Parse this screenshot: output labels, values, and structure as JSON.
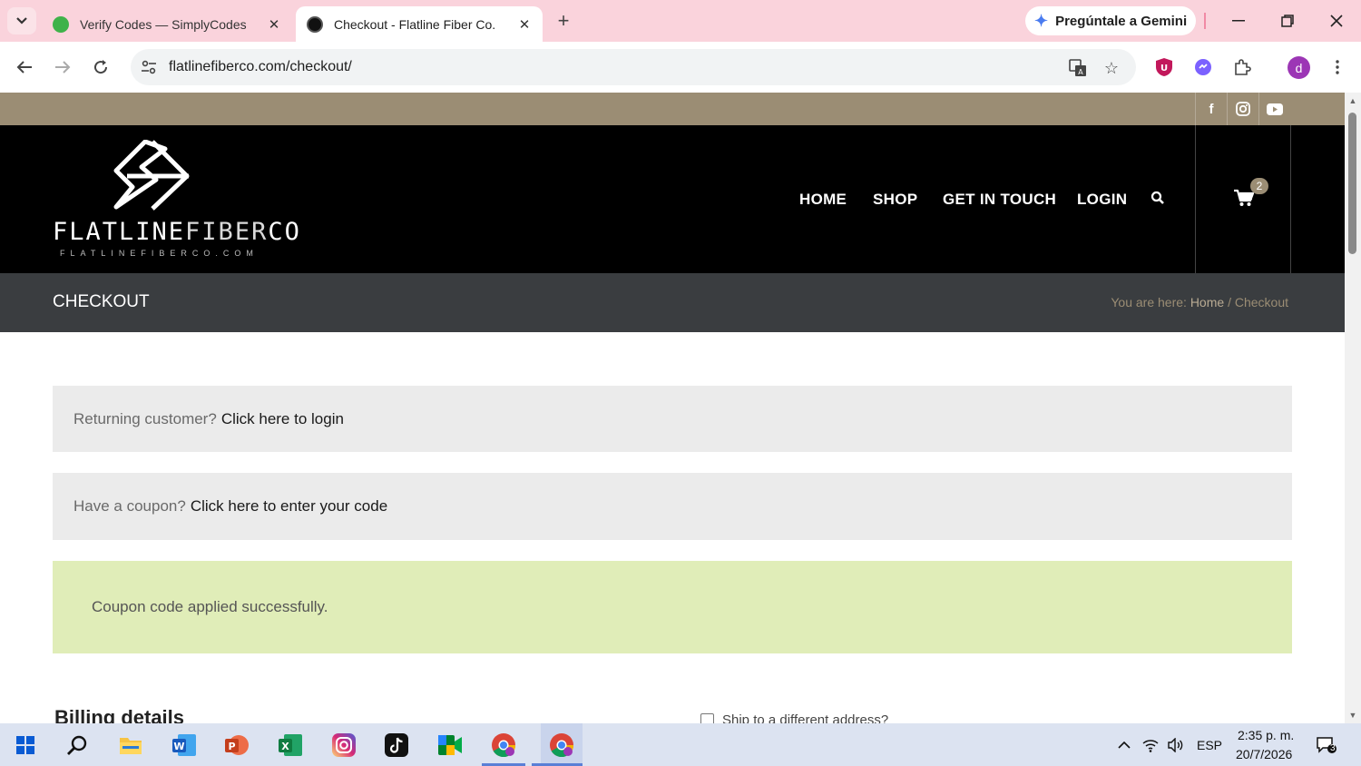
{
  "browser": {
    "tabs": [
      {
        "title": "Verify Codes — SimplyCodes",
        "active": false
      },
      {
        "title": "Checkout - Flatline Fiber Co.",
        "active": true
      }
    ],
    "gemini_label": "Pregúntale a Gemini",
    "url": "flatlinefiberco.com/checkout/",
    "profile_initial": "d"
  },
  "site": {
    "logo": {
      "name_bold": "FLATLINE",
      "name_thin": "FIBER",
      "name_end": "CO",
      "domain": "FLATLINEFIBERCO.COM"
    },
    "menu": [
      "HOME",
      "SHOP",
      "GET IN TOUCH",
      "LOGIN"
    ],
    "cart_count": "2",
    "page_title": "CHECKOUT",
    "breadcrumb": {
      "prefix": "You are here:",
      "home": "Home",
      "separator": "/",
      "current": "Checkout"
    },
    "returning": {
      "text": "Returning customer?",
      "link": "Click here to login"
    },
    "coupon": {
      "text": "Have a coupon?",
      "link": "Click here to enter your code"
    },
    "success_message": "Coupon code applied successfully.",
    "billing_title": "Billing details",
    "ship_label": "Ship to a different address?"
  },
  "taskbar": {
    "language": "ESP",
    "time": "2:35 p. m.",
    "date": "20/7/2026",
    "notifications": "3"
  },
  "colors": {
    "social_bar": "#9b8d74",
    "header": "#000000",
    "title_bar": "#3a3d40",
    "success_bg": "#e0edb8",
    "tab_strip": "#fad3dc"
  }
}
